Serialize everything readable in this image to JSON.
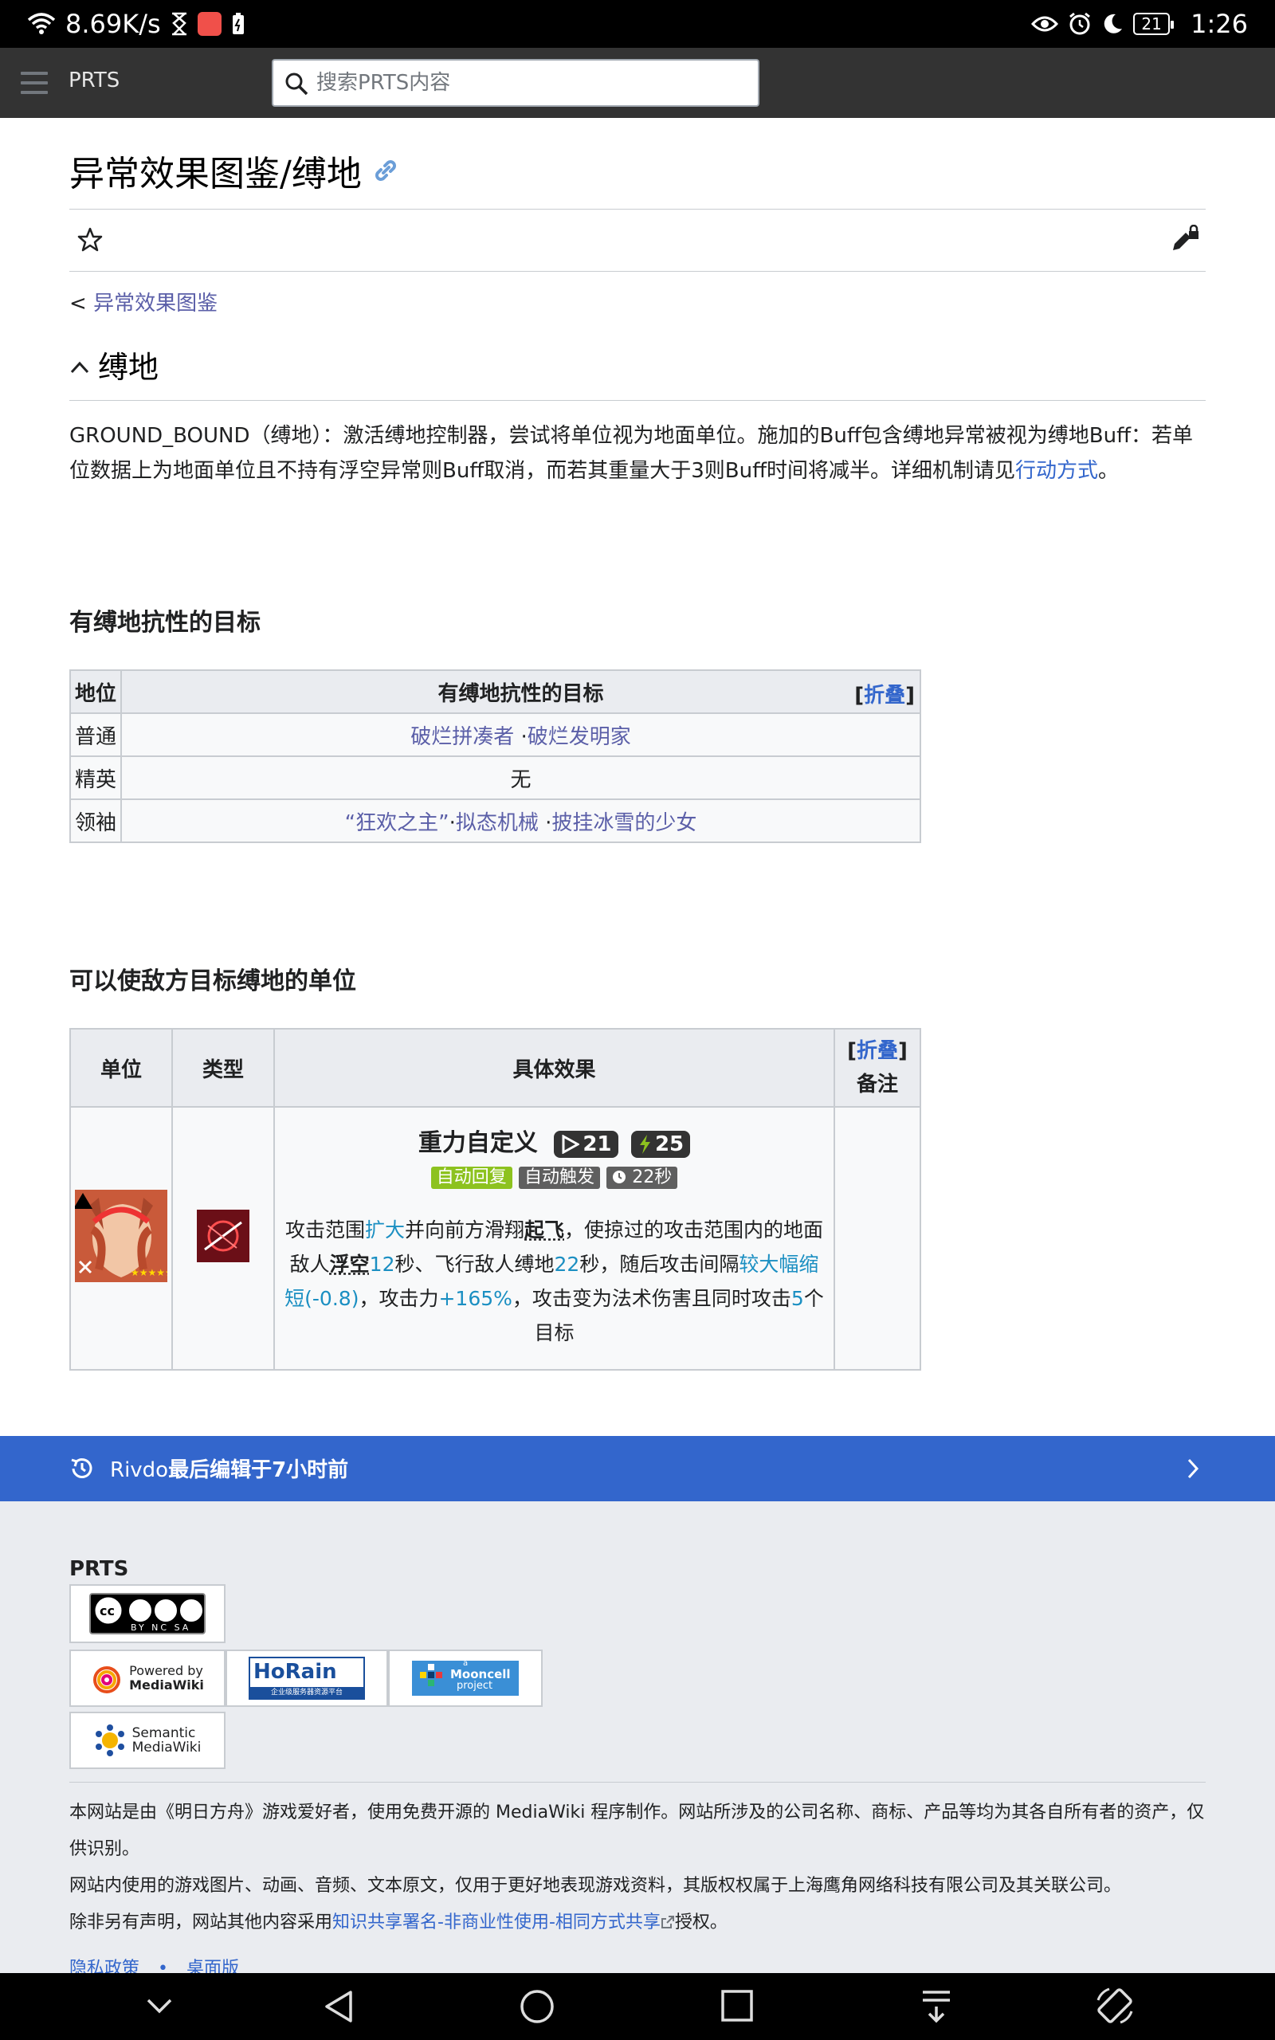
{
  "status_bar": {
    "speed": "8.69K/s",
    "battery": "21",
    "time": "1:26"
  },
  "header": {
    "brand": "PRTS",
    "search_placeholder": "搜索PRTS内容"
  },
  "page": {
    "title": "异常效果图鉴/缚地",
    "breadcrumb_prefix": "< ",
    "breadcrumb_link": "异常效果图鉴",
    "section_title": "缚地",
    "intro_text": "GROUND_BOUND（缚地）：激活缚地控制器，尝试将单位视为地面单位。施加的Buff包含缚地异常被视为缚地Buff：若单位数据上为地面单位且不持有浮空异常则Buff取消，而若其重量大于3则Buff时间将减半。详细机制请见",
    "intro_link": "行动方式",
    "intro_end": "。"
  },
  "resist_section": {
    "heading": "有缚地抗性的目标",
    "col_rank": "地位",
    "col_targets": "有缚地抗性的目标",
    "collapse": "折叠",
    "rows": [
      {
        "rank": "普通",
        "targets": [
          "破烂拼凑者",
          "破烂发明家"
        ]
      },
      {
        "rank": "精英",
        "none_text": "无"
      },
      {
        "rank": "领袖",
        "targets": [
          "“狂欢之主”",
          "拟态机械",
          "披挂冰雪的少女"
        ]
      }
    ]
  },
  "units_section": {
    "heading": "可以使敌方目标缚地的单位",
    "col_unit": "单位",
    "col_type": "类型",
    "col_effect": "具体效果",
    "col_notes": "备注",
    "collapse": "折叠",
    "skill": {
      "name": "重力自定义",
      "initial_sp": "21",
      "sp_cost": "25",
      "tag_recovery": "自动回复",
      "tag_trigger": "自动触发",
      "duration": "22秒",
      "desc": {
        "t1": "攻击范围",
        "k1": "扩大",
        "t2": "并向前方滑翔",
        "k2": "起飞",
        "t3": "，使掠过的攻击范围内的地面敌人",
        "k3": "浮空",
        "v1": "12",
        "t4": "秒、飞行敌人缚地",
        "v2": "22",
        "t5": "秒，随后攻击间隔",
        "v3": "较大幅缩短(-0.8)",
        "t6": "，攻击力",
        "v4": "+165%",
        "t7": "，攻击变为法术伤害且同时攻击",
        "v5": "5",
        "t8": "个目标"
      }
    }
  },
  "edit_bar": {
    "user": "Rivdo",
    "text": "最后编辑于7小时前"
  },
  "footer": {
    "site": "PRTS",
    "badge_cc": "BY NC SA",
    "badge_mw_top": "Powered by",
    "badge_mw_bottom": "MediaWiki",
    "badge_horain": "HoRain",
    "badge_horain_sub": "企业级服务器资源平台",
    "badge_mooncell_top": "a",
    "badge_mooncell": "Mooncell",
    "badge_mooncell_sub": "project",
    "badge_smw_top": "Semantic",
    "badge_smw_bottom": "MediaWiki",
    "p1": "本网站是由《明日方舟》游戏爱好者，使用免费开源的 MediaWiki 程序制作。网站所涉及的公司名称、商标、产品等均为其各自所有者的资产，仅供识别。",
    "p2": "网站内使用的游戏图片、动画、音频、文本原文，仅用于更好地表现游戏资料，其版权权属于上海鹰角网络科技有限公司及其关联公司。",
    "p3_prefix": "除非另有声明，网站其他内容采用",
    "p3_link": "知识共享署名-非商业性使用-相同方式共享",
    "p3_suffix": "授权。",
    "privacy": "隐私政策",
    "dot": "•",
    "desktop": "桌面版"
  },
  "colors": {
    "header_bg": "#333333",
    "edit_bar": "#3366cc",
    "link": "#5b5fa8",
    "value_blue": "#1b8fc2",
    "badge_green": "#8dc21f",
    "badge_gray": "#5f5f5f"
  }
}
